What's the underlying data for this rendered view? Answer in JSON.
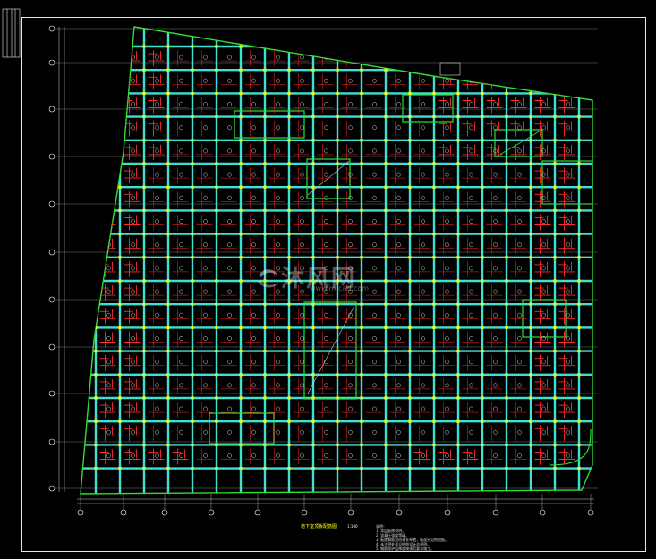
{
  "drawing": {
    "title": "地下室顶板配筋图",
    "scale": "1:100",
    "notes": [
      "说明：",
      "1. 本层板厚说明。",
      "2. 混凝土强度等级。",
      "3. 板底钢筋双向通长布置，板面另见附加筋。",
      "4. 未注明处详见结构设计总说明。",
      "5. 钢筋保护层厚度按规范要求施工。"
    ]
  },
  "watermark": {
    "brand": "沐风网",
    "url": "www.mfcad.com"
  },
  "colors": {
    "background": "#000000",
    "frame": "#e8e8e8",
    "beam": "#40e0d0",
    "outline": "#33dd33",
    "rebar": "#ff2a2a",
    "column": "#ffff00",
    "axis": "#ffffff",
    "title": "#ffff00"
  },
  "icons": [
    "logo-mark"
  ]
}
